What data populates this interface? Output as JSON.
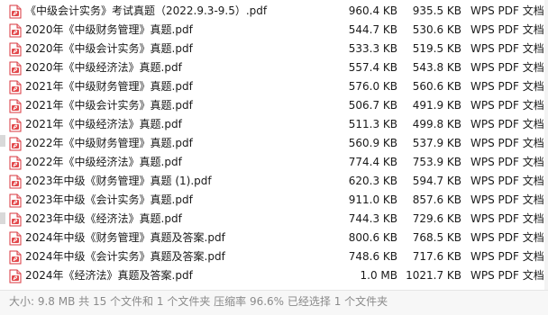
{
  "files": [
    {
      "name": "《中级会计实务》考试真题（2022.9.3-9.5）.pdf",
      "size": "960.4 KB",
      "packed": "935.5 KB",
      "type": "WPS PDF 文档"
    },
    {
      "name": "2020年《中级财务管理》真题.pdf",
      "size": "544.7 KB",
      "packed": "530.6 KB",
      "type": "WPS PDF 文档"
    },
    {
      "name": "2020年《中级会计实务》真题.pdf",
      "size": "533.3 KB",
      "packed": "519.5 KB",
      "type": "WPS PDF 文档"
    },
    {
      "name": "2020年《中级经济法》真题.pdf",
      "size": "557.4 KB",
      "packed": "543.8 KB",
      "type": "WPS PDF 文档"
    },
    {
      "name": "2021年《中级财务管理》真题.pdf",
      "size": "576.0 KB",
      "packed": "560.6 KB",
      "type": "WPS PDF 文档"
    },
    {
      "name": "2021年《中级会计实务》真题.pdf",
      "size": "506.7 KB",
      "packed": "491.9 KB",
      "type": "WPS PDF 文档"
    },
    {
      "name": "2021年《中级经济法》真题.pdf",
      "size": "511.3 KB",
      "packed": "499.8 KB",
      "type": "WPS PDF 文档"
    },
    {
      "name": "2022年《中级财务管理》真题.pdf",
      "size": "560.9 KB",
      "packed": "537.9 KB",
      "type": "WPS PDF 文档"
    },
    {
      "name": "2022年《中级经济法》真题.pdf",
      "size": "774.4 KB",
      "packed": "753.9 KB",
      "type": "WPS PDF 文档"
    },
    {
      "name": "2023年中级《财务管理》真题 (1).pdf",
      "size": "620.3 KB",
      "packed": "594.7 KB",
      "type": "WPS PDF 文档"
    },
    {
      "name": "2023年中级《会计实务》真题.pdf",
      "size": "911.0 KB",
      "packed": "857.6 KB",
      "type": "WPS PDF 文档"
    },
    {
      "name": "2023年中级《经济法》真题.pdf",
      "size": "744.3 KB",
      "packed": "729.6 KB",
      "type": "WPS PDF 文档"
    },
    {
      "name": "2024年中级《财务管理》真题及答案.pdf",
      "size": "800.6 KB",
      "packed": "768.5 KB",
      "type": "WPS PDF 文档"
    },
    {
      "name": "2024年中级《会计实务》真题及答案.pdf",
      "size": "748.6 KB",
      "packed": "717.6 KB",
      "type": "WPS PDF 文档"
    },
    {
      "name": "2024年《经济法》真题及答案.pdf",
      "size": "1.0 MB",
      "packed": "1021.7 KB",
      "type": "WPS PDF 文档"
    }
  ],
  "icons": {
    "file": "wps-pdf-icon",
    "color": "#e2474a"
  },
  "status": {
    "text": "大小: 9.8 MB 共 15 个文件和 1 个文件夹 压缩率 96.6% 已经选择 1 个文件夹"
  }
}
